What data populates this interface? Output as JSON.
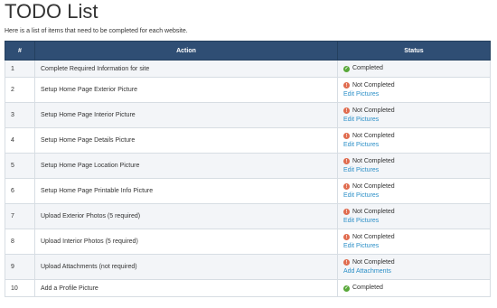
{
  "page": {
    "title": "TODO List",
    "subtitle": "Here is a list of items that need to be completed for each website."
  },
  "table": {
    "headers": {
      "num": "#",
      "action": "Action",
      "status": "Status"
    },
    "rows": [
      {
        "num": "1",
        "action": "Complete Required Information for site",
        "status": "Completed",
        "state": "done",
        "link": ""
      },
      {
        "num": "2",
        "action": "Setup Home Page Exterior Picture",
        "status": "Not Completed",
        "state": "todo",
        "link": "Edit Pictures"
      },
      {
        "num": "3",
        "action": "Setup Home Page Interior Picture",
        "status": "Not Completed",
        "state": "todo",
        "link": "Edit Pictures"
      },
      {
        "num": "4",
        "action": "Setup Home Page Details Picture",
        "status": "Not Completed",
        "state": "todo",
        "link": "Edit Pictures"
      },
      {
        "num": "5",
        "action": "Setup Home Page Location Picture",
        "status": "Not Completed",
        "state": "todo",
        "link": "Edit Pictures"
      },
      {
        "num": "6",
        "action": "Setup Home Page Printable Info Picture",
        "status": "Not Completed",
        "state": "todo",
        "link": "Edit Pictures"
      },
      {
        "num": "7",
        "action": "Upload Exterior Photos (5 required)",
        "status": "Not Completed",
        "state": "todo",
        "link": "Edit Pictures"
      },
      {
        "num": "8",
        "action": "Upload Interior Photos (5 required)",
        "status": "Not Completed",
        "state": "todo",
        "link": "Edit Pictures"
      },
      {
        "num": "9",
        "action": "Upload Attachments (not required)",
        "status": "Not Completed",
        "state": "todo",
        "link": "Add Attachments"
      },
      {
        "num": "10",
        "action": "Add a Profile Picture",
        "status": "Completed",
        "state": "done",
        "link": ""
      }
    ]
  },
  "icons": {
    "done": "check-circle-icon",
    "todo": "exclamation-circle-icon"
  },
  "colors": {
    "header_bg": "#2f4e74",
    "link": "#2b8fc7",
    "success": "#59a83a",
    "warning": "#e06c4f"
  }
}
